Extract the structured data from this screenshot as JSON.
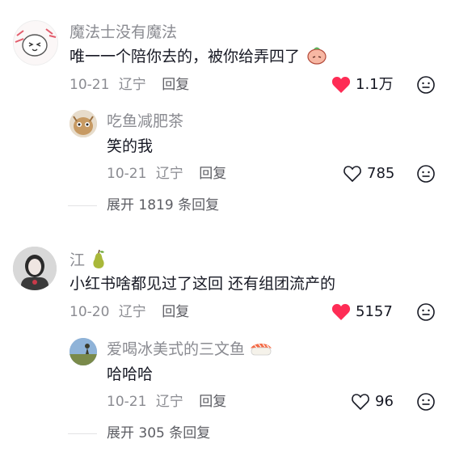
{
  "comments": [
    {
      "username": "魔法士没有魔法",
      "text": "唯一一个陪你去的，被你给弄四了",
      "date": "10-21",
      "location": "辽宁",
      "reply_label": "回复",
      "likes": "1.1万",
      "liked": true,
      "replies": [
        {
          "username": "吃鱼减肥茶",
          "text": "笑的我",
          "date": "10-21",
          "location": "辽宁",
          "reply_label": "回复",
          "likes": "785",
          "liked": false
        }
      ],
      "expand_label": "展开 1819 条回复"
    },
    {
      "username": "江",
      "text": "小红书啥都见过了这回 还有组团流产的",
      "date": "10-20",
      "location": "辽宁",
      "reply_label": "回复",
      "likes": "5157",
      "liked": true,
      "replies": [
        {
          "username": "爱喝冰美式的三文鱼",
          "text": "哈哈哈",
          "date": "10-21",
          "location": "辽宁",
          "reply_label": "回复",
          "likes": "96",
          "liked": false
        }
      ],
      "expand_label": "展开 305 条回复"
    }
  ],
  "colors": {
    "like_red": "#fe2c55",
    "meta_gray": "#8a8b91"
  }
}
